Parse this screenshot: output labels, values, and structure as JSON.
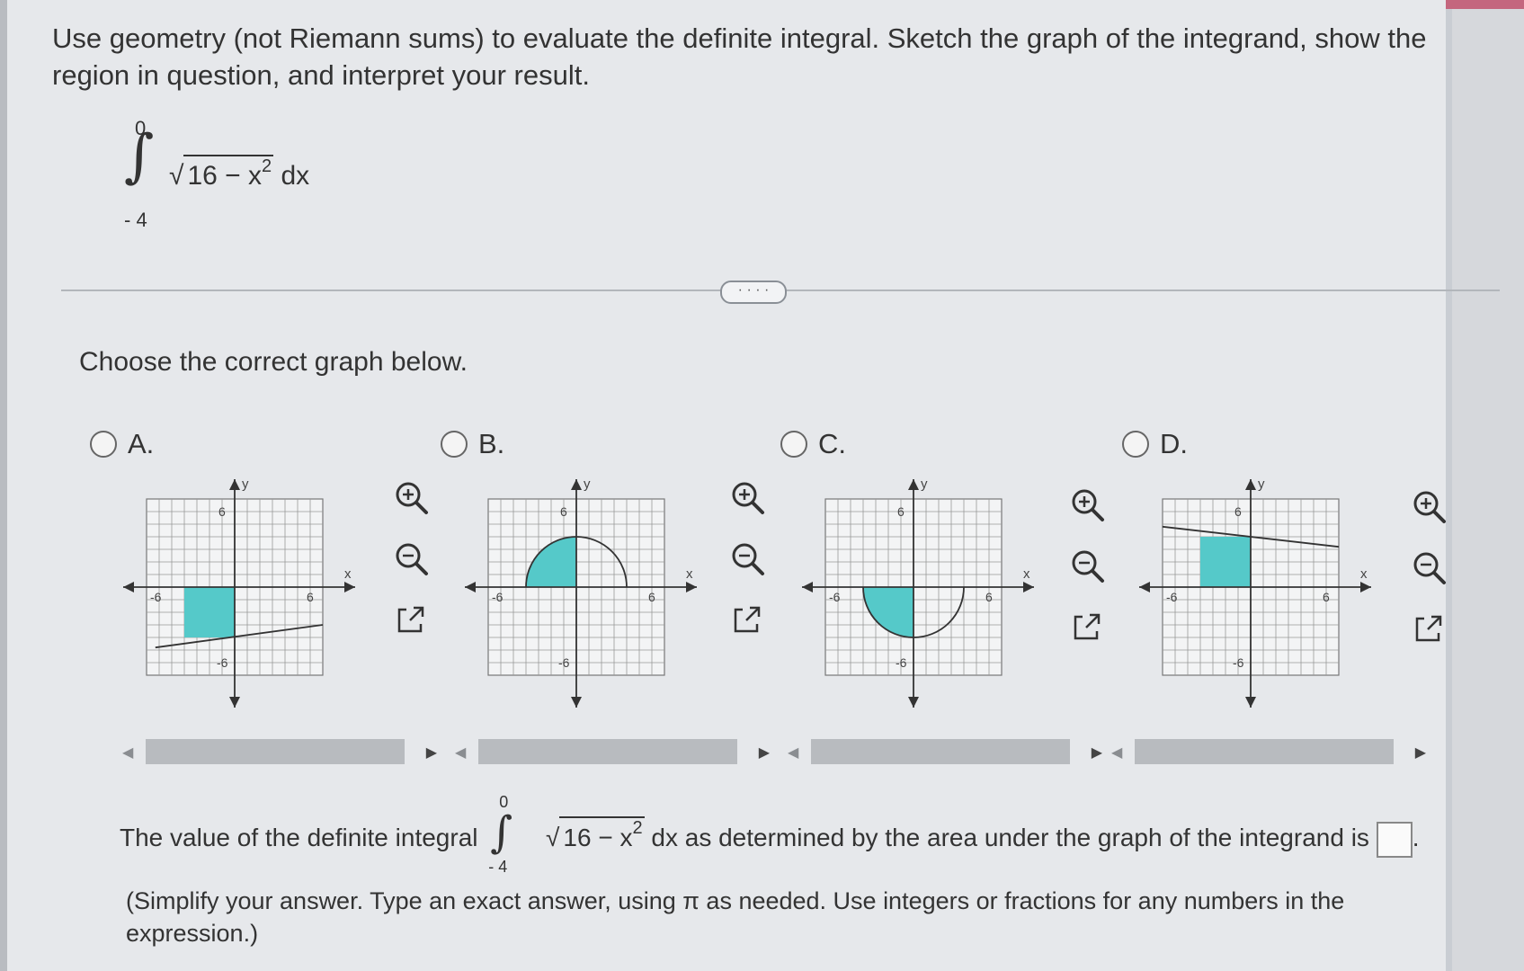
{
  "question": {
    "text": "Use geometry (not Riemann sums) to evaluate the definite integral. Sketch the graph of the integrand, show the region in question, and interpret your result."
  },
  "integral": {
    "sign": "∫",
    "upper": "0",
    "lower": "- 4",
    "radicand": "16 − x",
    "exponent": "2",
    "differential": "dx",
    "radical_symbol": "√"
  },
  "more_button": "· · · ·",
  "prompt": "Choose the correct graph below.",
  "options": [
    {
      "label": "A.",
      "description": "square shaded region in lower left quadrant with slanted line"
    },
    {
      "label": "B.",
      "description": "quarter circle shaded above x-axis on left"
    },
    {
      "label": "C.",
      "description": "quarter circle shaded below x-axis on left"
    },
    {
      "label": "D.",
      "description": "square shaded region in upper left quadrant with slanted line"
    }
  ],
  "graph_labels": {
    "x": "x",
    "y": "y",
    "pos6": "6",
    "neg6": "-6"
  },
  "answer": {
    "prefix": "The value of the definite integral",
    "suffix": "dx as determined by the area under the graph of the integrand is",
    "note": "(Simplify your answer. Type an exact answer, using π as needed. Use integers or fractions for any numbers in the expression.)"
  },
  "colors": {
    "shade": "#55c9c9",
    "grid": "#8e8e8e",
    "background": "#e6e8eb"
  },
  "icons": [
    "zoom-in-icon",
    "zoom-out-icon",
    "popout-icon"
  ]
}
